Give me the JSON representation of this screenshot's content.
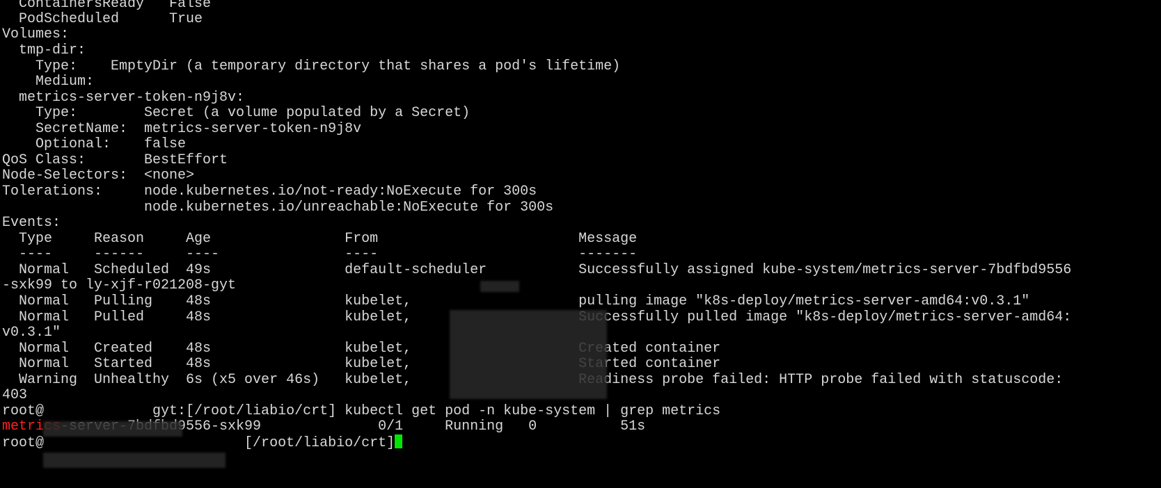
{
  "terminal": {
    "lines": [
      "  ContainersReady   False",
      "  PodScheduled      True",
      "Volumes:",
      "  tmp-dir:",
      "    Type:    EmptyDir (a temporary directory that shares a pod's lifetime)",
      "    Medium:",
      "  metrics-server-token-n9j8v:",
      "    Type:        Secret (a volume populated by a Secret)",
      "    SecretName:  metrics-server-token-n9j8v",
      "    Optional:    false",
      "QoS Class:       BestEffort",
      "Node-Selectors:  <none>",
      "Tolerations:     node.kubernetes.io/not-ready:NoExecute for 300s",
      "                 node.kubernetes.io/unreachable:NoExecute for 300s",
      "Events:",
      "  Type     Reason     Age                From                        Message",
      "  ----     ------     ----               ----                        -------",
      "  Normal   Scheduled  49s                default-scheduler           Successfully assigned kube-system/metrics-server-7bdfbd9556",
      "-sxk99 to ly-xjf-r021208-gyt",
      "  Normal   Pulling    48s                kubelet,                    pulling image \"k8s-deploy/metrics-server-amd64:v0.3.1\"",
      "  Normal   Pulled     48s                kubelet,                    Successfully pulled image \"k8s-deploy/metrics-server-amd64:",
      "v0.3.1\"",
      "  Normal   Created    48s                kubelet,                    Created container",
      "  Normal   Started    48s                kubelet,                    Started container",
      "  Warning  Unhealthy  6s (x5 over 46s)   kubelet,                    Readiness probe failed: HTTP probe failed with statuscode:",
      "403",
      "root@             gyt:[/root/liabio/crt] kubectl get pod -n kube-system | grep metrics"
    ],
    "result_line": {
      "highlight": "metrics",
      "rest": "-server-7bdfbd9556-sxk99              0/1     Running   0          51s"
    },
    "prompt_line": "root@                        [/root/liabio/crt]"
  },
  "colors": {
    "background": "#000000",
    "text": "#d8d8d8",
    "highlight": "#ff2020",
    "cursor": "#00e600"
  }
}
